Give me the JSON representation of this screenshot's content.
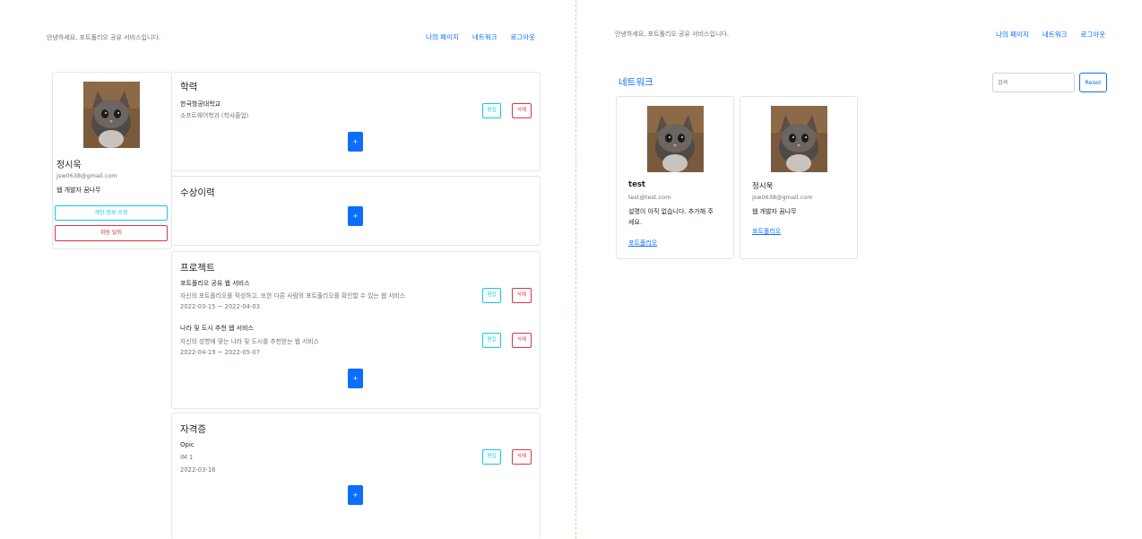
{
  "app": {
    "greeting": "안녕하세요, 포트폴리오 공유 서비스입니다.",
    "nav": [
      "나의 페이지",
      "네트워크",
      "로그아웃"
    ]
  },
  "profile": {
    "name": "정시욱",
    "email": "jsw0638@gmail.com",
    "description": "웹 개발자 꿈나무",
    "edit_button": "개인 정보 수정",
    "withdraw_button": "회원 탈퇴"
  },
  "buttons": {
    "edit": "편집",
    "delete": "삭제",
    "add": "+"
  },
  "education": {
    "title": "학력",
    "items": [
      {
        "school": "한국항공대학교",
        "major": "소프트웨어학과 (학사졸업)"
      }
    ]
  },
  "awards": {
    "title": "수상이력",
    "items": []
  },
  "projects": {
    "title": "프로젝트",
    "items": [
      {
        "title": "포트폴리오 공유 웹 서비스",
        "description": "자신의 포트폴리오를 작성하고, 또한 다른 사람의 포트폴리오를 확인할 수 있는 웹 서비스",
        "period": "2022-03-15 ~ 2022-04-03"
      },
      {
        "title": "나라 및 도시 추천 웹 서비스",
        "description": "자신의 성향에 맞는 나라 및 도시를 추천받는 웹 서비스",
        "period": "2022-04-19 ~ 2022-05-07"
      }
    ]
  },
  "certificates": {
    "title": "자격증",
    "items": [
      {
        "title": "Opic",
        "grade": "IM 1",
        "date": "2022-03-16"
      }
    ]
  },
  "network": {
    "title": "네트워크",
    "search_placeholder": "검색",
    "reset_label": "Reset",
    "link_label": "포트폴리오",
    "users": [
      {
        "name": "test",
        "email": "test@test.com",
        "description": "설명이 아직 없습니다. 추가해 주세요."
      },
      {
        "name": "정시욱",
        "email": "jsw0638@gmail.com",
        "description": "웹 개발자 꿈나무"
      }
    ]
  },
  "colors": {
    "primary": "#0d6efd",
    "info": "#0dcaf0",
    "danger": "#dc3545",
    "muted": "#6c757d",
    "divider": "#f0c48a"
  }
}
